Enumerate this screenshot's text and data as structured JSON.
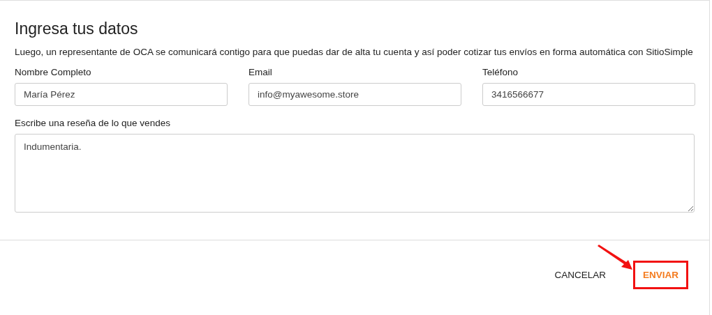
{
  "title": "Ingresa tus datos",
  "description": "Luego, un representante de OCA se comunicará contigo para que puedas dar de alta tu cuenta y así poder cotizar tus envíos en forma automática con SitioSimple",
  "fields": [
    {
      "label": "Nombre Completo",
      "value": "María Pérez"
    },
    {
      "label": "Email",
      "value": "info@myawesome.store"
    },
    {
      "label": "Teléfono",
      "value": "3416566677"
    }
  ],
  "review": {
    "label": "Escribe una reseña de lo que vendes",
    "value": "Indumentaria."
  },
  "buttons": [
    {
      "label": "CANCELAR",
      "kind": "text",
      "annotated": false
    },
    {
      "label": "ENVIAR",
      "kind": "primary",
      "annotated": true
    }
  ]
}
